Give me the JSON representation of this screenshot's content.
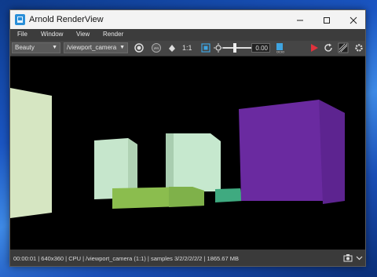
{
  "window": {
    "title": "Arnold RenderView"
  },
  "menu": [
    "File",
    "Window",
    "View",
    "Render"
  ],
  "toolbar": {
    "aov": "Beauty",
    "camera": "/viewport_camera",
    "ratio": "1:1",
    "exposure": "0.00"
  },
  "status": {
    "text": "00:00:01 | 640x360 | CPU | /viewport_camera (1:1) | samples 3/2/2/2/2/2 | 1865.67 MB"
  },
  "colors": {
    "render_button": "#e0323c",
    "purple_box": "#6a2aa0",
    "green_box": "#8bbd4e"
  }
}
